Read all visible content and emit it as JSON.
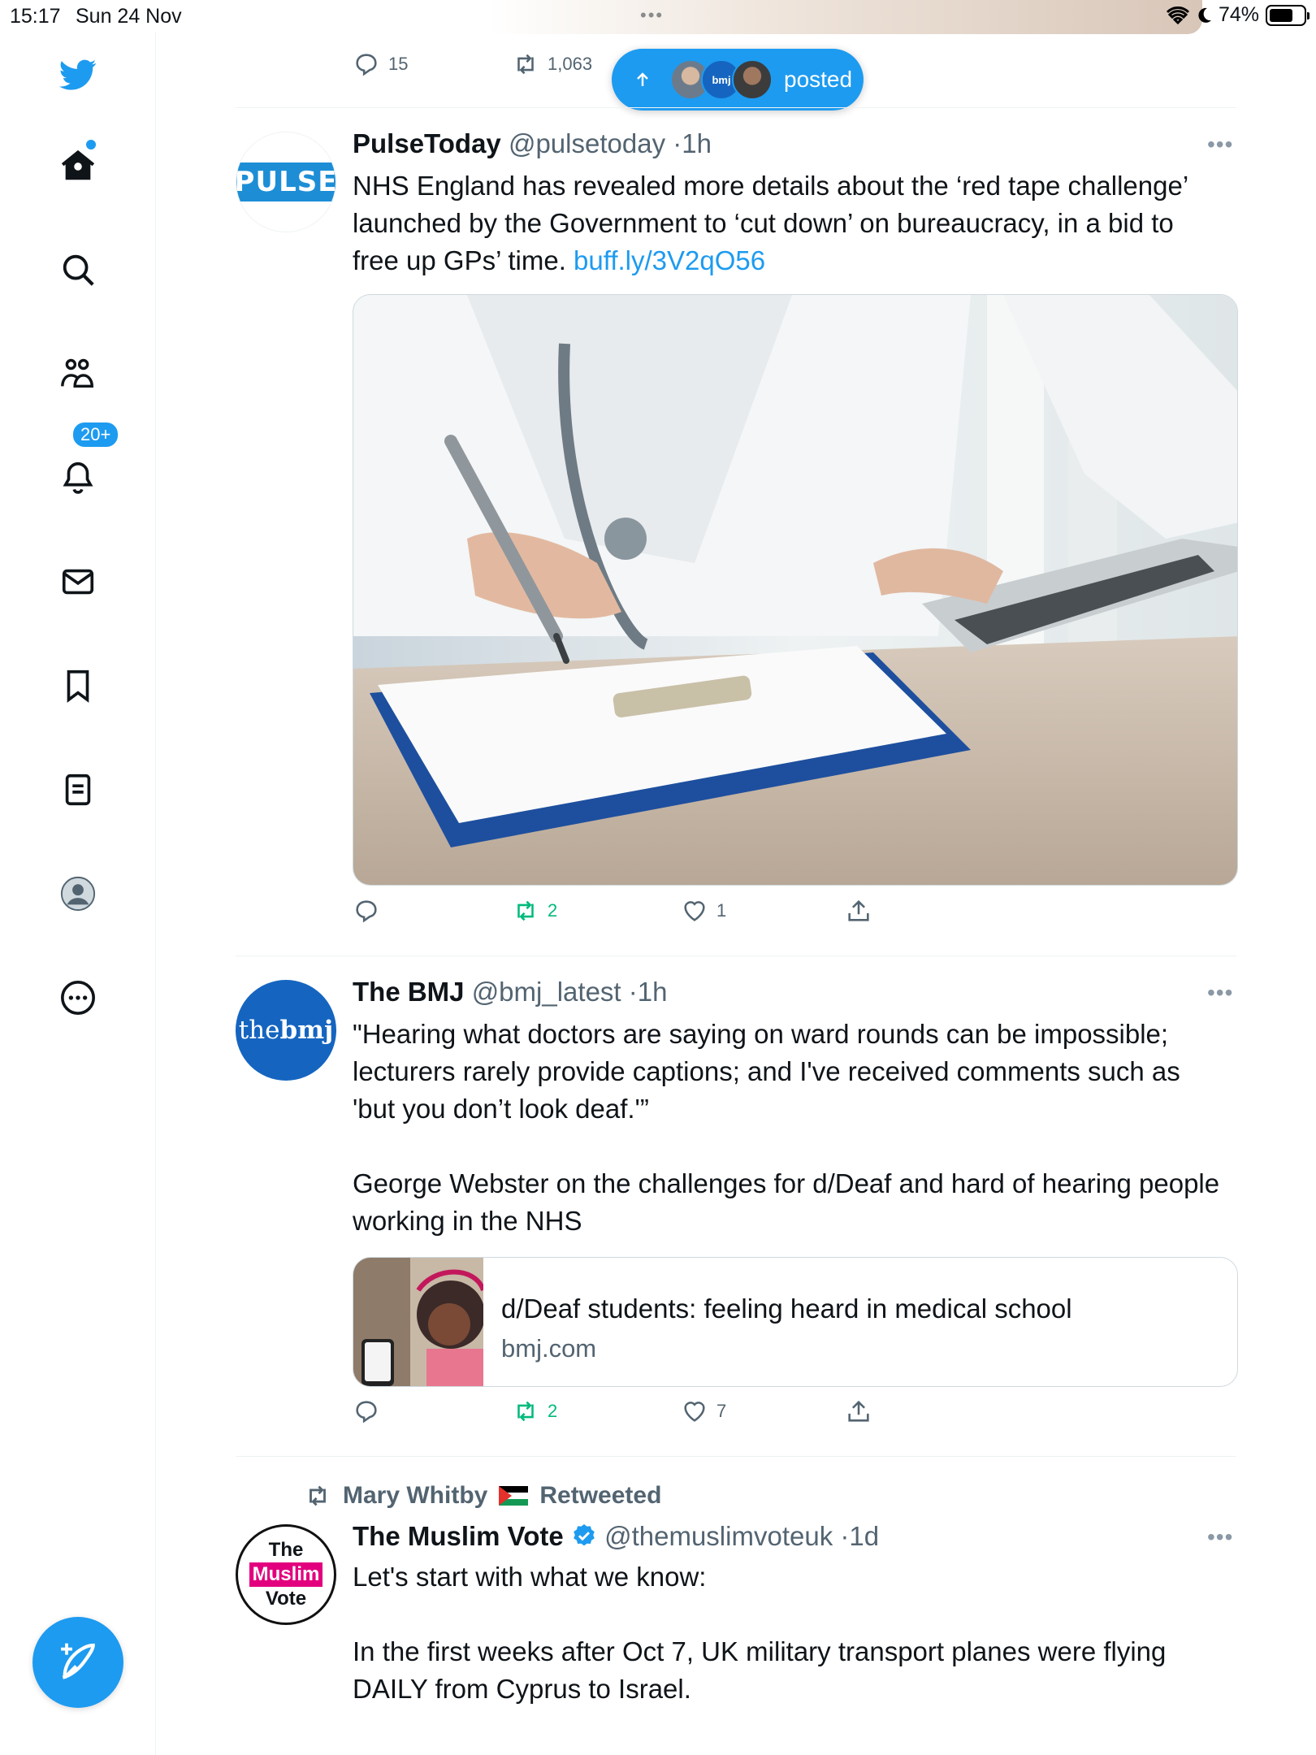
{
  "status_bar": {
    "time": "15:17",
    "date": "Sun 24 Nov",
    "battery": "74%"
  },
  "sidebar": {
    "items": [
      {
        "name": "logo"
      },
      {
        "name": "home"
      },
      {
        "name": "explore"
      },
      {
        "name": "communities"
      },
      {
        "name": "notifications"
      },
      {
        "name": "messages"
      },
      {
        "name": "bookmarks"
      },
      {
        "name": "lists"
      },
      {
        "name": "profile"
      },
      {
        "name": "more"
      }
    ],
    "notifications_badge": "20+"
  },
  "new_posts_pill": {
    "label": "posted",
    "avatar_text": "bmj"
  },
  "prev_tweet": {
    "replies": "15",
    "retweets": "1,063"
  },
  "tweets": [
    {
      "avatar_text": "PULSE",
      "name": "PulseToday",
      "handle": "@pulsetoday",
      "time": "1h",
      "text": "NHS England has revealed more details about the ‘red tape challenge’ launched by the Government to ‘cut down’ on bureaucracy, in a bid to free up GPs’ time. ",
      "link": "buff.ly/3V2qO56",
      "retweets": "2",
      "likes": "1"
    },
    {
      "avatar_text_a": "the",
      "avatar_text_b": "bmj",
      "name": "The BMJ",
      "handle": "@bmj_latest",
      "time": "1h",
      "text_p1": "\"Hearing what doctors are saying on ward rounds can be impossible; lecturers rarely provide captions; and I've received comments such as 'but you don’t look deaf.'”",
      "text_p2": "George Webster on the challenges for d/Deaf and hard of hearing people working in the NHS",
      "card_title": "d/Deaf students: feeling heard in medical school",
      "card_domain": "bmj.com",
      "retweets": "2",
      "likes": "7"
    },
    {
      "retweeted_by": "Mary Whitby",
      "retweeted_label": "Retweeted",
      "avatar_lines": [
        "The",
        "Muslim",
        "Vote"
      ],
      "name": "The Muslim Vote",
      "handle": "@themuslimvoteuk",
      "time": "1d",
      "text_p1": "Let's start with what we know:",
      "text_p2": "In the first weeks after Oct 7, UK military transport planes were flying DAILY from Cyprus to Israel."
    }
  ],
  "separator": "·",
  "more_glyph": "•••",
  "colors": {
    "accent": "#1d9bf0",
    "retweet_green": "#00ba7c",
    "muted": "#536471",
    "bmj_blue": "#1565c0",
    "muslim_vote_pink": "#e3007e"
  }
}
